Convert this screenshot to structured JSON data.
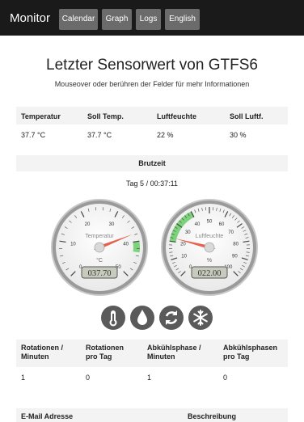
{
  "nav": {
    "brand": "Monitor",
    "items": [
      "Calendar",
      "Graph",
      "Logs",
      "English"
    ]
  },
  "header": {
    "title": "Letzter Sensorwert von GTFS6",
    "subtitle": "Mouseover oder berühren der Felder für mehr Informationen"
  },
  "sensor_table": {
    "headers": [
      "Temperatur",
      "Soll Temp.",
      "Luftfeuchte",
      "Soll Luftf."
    ],
    "values": [
      "37.7 °C",
      "37.7 °C",
      "22 %",
      "30 %"
    ]
  },
  "brutzeit": {
    "label": "Brutzeit",
    "value": "Tag 5  /  00:37:11"
  },
  "gauges": [
    {
      "title": "Temperatur",
      "unit": "°C",
      "value": 37.7,
      "display": "037.70",
      "min": 0,
      "max": 50,
      "ticks": [
        "0",
        "10",
        "20",
        "30",
        "40",
        "50"
      ],
      "highlight": [
        40,
        43
      ],
      "highlight_color": "#7dd37d"
    },
    {
      "title": "Luftfeuchte",
      "unit": "%",
      "value": 22,
      "display": "022.00",
      "min": 0,
      "max": 100,
      "ticks": [
        "0",
        "10",
        "20",
        "30",
        "40",
        "50",
        "60",
        "70",
        "80",
        "90",
        "100"
      ],
      "highlight": [
        20,
        40
      ],
      "highlight_color": "#7dd37d"
    }
  ],
  "icons": [
    "thermometer-icon",
    "droplet-icon",
    "rotate-icon",
    "snowflake-icon"
  ],
  "rotation_table": {
    "headers": [
      "Rotationen / Minuten",
      "Rotationen pro Tag",
      "Abkühlsphase / Minuten",
      "Abkühlsphasen pro Tag"
    ],
    "values": [
      "1",
      "0",
      "1",
      "0"
    ]
  },
  "email_table": {
    "headers": [
      "E-Mail Adresse",
      "Beschreibung"
    ]
  },
  "colors": {
    "navbar": "#1a1a1a",
    "nav_button": "#6b6b6b",
    "header_bg": "#f3f3f3",
    "needle": "#e8614f",
    "gauge_green": "#7dd37d",
    "icon_bg": "#5a5a5a"
  }
}
